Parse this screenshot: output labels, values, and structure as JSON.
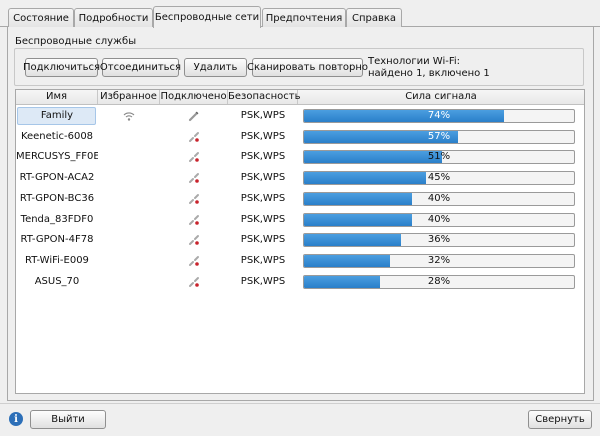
{
  "tabs": [
    {
      "label": "Состояние"
    },
    {
      "label": "Подробности"
    },
    {
      "label": "Беспроводные сети"
    },
    {
      "label": "Предпочтения"
    },
    {
      "label": "Справка"
    }
  ],
  "active_tab": 2,
  "section_title": "Беспроводные службы",
  "buttons": {
    "connect": "Подключиться",
    "disconnect": "Отсоединиться",
    "remove": "Удалить",
    "rescan": "Сканировать повторно"
  },
  "wifi_info": {
    "line1": "Технологии Wi-Fi:",
    "line2": "найдено 1, включено 1"
  },
  "columns": {
    "name": "Имя",
    "favorite": "Избранное",
    "connected": "Подключено",
    "security": "Безопасность",
    "signal": "Сила сигнала"
  },
  "networks": [
    {
      "name": "Family",
      "security": "PSK,WPS",
      "signal": 74,
      "signal_label": "74%",
      "favorite": true,
      "connected": true
    },
    {
      "name": "Keenetic-6008",
      "security": "PSK,WPS",
      "signal": 57,
      "signal_label": "57%",
      "favorite": false,
      "connected": false
    },
    {
      "name": "MERCUSYS_FF0E",
      "security": "PSK,WPS",
      "signal": 51,
      "signal_label": "51%",
      "favorite": false,
      "connected": false
    },
    {
      "name": "RT-GPON-ACA2",
      "security": "PSK,WPS",
      "signal": 45,
      "signal_label": "45%",
      "favorite": false,
      "connected": false
    },
    {
      "name": "RT-GPON-BC36",
      "security": "PSK,WPS",
      "signal": 40,
      "signal_label": "40%",
      "favorite": false,
      "connected": false
    },
    {
      "name": "Tenda_83FDF0",
      "security": "PSK,WPS",
      "signal": 40,
      "signal_label": "40%",
      "favorite": false,
      "connected": false
    },
    {
      "name": "RT-GPON-4F78",
      "security": "PSK,WPS",
      "signal": 36,
      "signal_label": "36%",
      "favorite": false,
      "connected": false
    },
    {
      "name": "RT-WiFi-E009",
      "security": "PSK,WPS",
      "signal": 32,
      "signal_label": "32%",
      "favorite": false,
      "connected": false
    },
    {
      "name": "ASUS_70",
      "security": "PSK,WPS",
      "signal": 28,
      "signal_label": "28%",
      "favorite": false,
      "connected": false
    }
  ],
  "footer": {
    "quit": "Выйти",
    "minimize": "Свернуть"
  },
  "colors": {
    "accent": "#2a7fc9",
    "selection": "#dde9f6"
  }
}
